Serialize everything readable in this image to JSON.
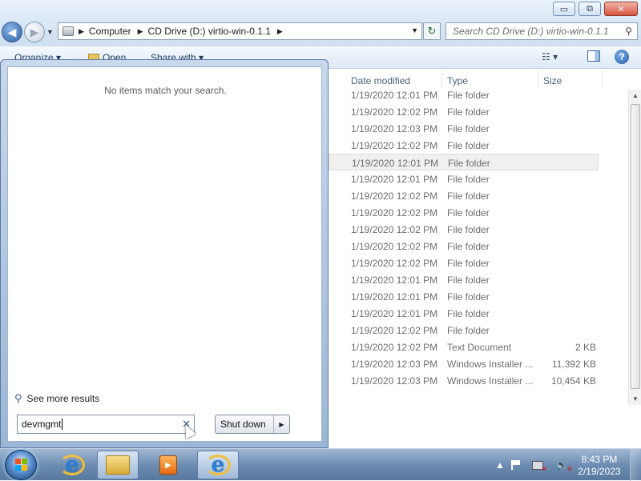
{
  "window": {
    "caption_buttons": {
      "minimize": "▭",
      "maximize": "⧉",
      "close": "✕"
    }
  },
  "navigation": {
    "back_glyph": "◀",
    "forward_glyph": "▶",
    "breadcrumbs": [
      "Computer",
      "CD Drive (D:) virtio-win-0.1.1"
    ],
    "search_placeholder": "Search CD Drive (D:) virtio-win-0.1.1"
  },
  "toolbar": {
    "organize": "Organize ▾",
    "open": "Open",
    "share_with": "Share with ▾",
    "views": "☷ ▾",
    "help": "?"
  },
  "columns": {
    "date_modified": "Date modified",
    "type": "Type",
    "size": "Size"
  },
  "files": [
    {
      "date": "1/19/2020 12:01 PM",
      "type": "File folder",
      "size": ""
    },
    {
      "date": "1/19/2020 12:02 PM",
      "type": "File folder",
      "size": ""
    },
    {
      "date": "1/19/2020 12:03 PM",
      "type": "File folder",
      "size": ""
    },
    {
      "date": "1/19/2020 12:02 PM",
      "type": "File folder",
      "size": ""
    },
    {
      "date": "1/19/2020 12:01 PM",
      "type": "File folder",
      "size": ""
    },
    {
      "date": "1/19/2020 12:01 PM",
      "type": "File folder",
      "size": ""
    },
    {
      "date": "1/19/2020 12:02 PM",
      "type": "File folder",
      "size": ""
    },
    {
      "date": "1/19/2020 12:02 PM",
      "type": "File folder",
      "size": ""
    },
    {
      "date": "1/19/2020 12:02 PM",
      "type": "File folder",
      "size": ""
    },
    {
      "date": "1/19/2020 12:02 PM",
      "type": "File folder",
      "size": ""
    },
    {
      "date": "1/19/2020 12:02 PM",
      "type": "File folder",
      "size": ""
    },
    {
      "date": "1/19/2020 12:01 PM",
      "type": "File folder",
      "size": ""
    },
    {
      "date": "1/19/2020 12:01 PM",
      "type": "File folder",
      "size": ""
    },
    {
      "date": "1/19/2020 12:01 PM",
      "type": "File folder",
      "size": ""
    },
    {
      "date": "1/19/2020 12:02 PM",
      "type": "File folder",
      "size": ""
    },
    {
      "date": "1/19/2020 12:02 PM",
      "type": "Text Document",
      "size": "2 KB"
    },
    {
      "date": "1/19/2020 12:03 PM",
      "type": "Windows Installer ...",
      "size": "11,392 KB"
    },
    {
      "date": "1/19/2020 12:03 PM",
      "type": "Windows Installer ...",
      "size": "10,454 KB"
    }
  ],
  "hovered_row_index": 4,
  "start_menu": {
    "no_items_text": "No items match your search.",
    "see_more": "See more results",
    "search_value": "devmgmt",
    "clear_glyph": "✕",
    "shutdown_label": "Shut down",
    "shutdown_arrow": "▶"
  },
  "taskbar": {
    "clock_time": "8:43 PM",
    "clock_date": "2/19/2023",
    "tray_up_arrow": "▲"
  },
  "colors": {
    "accent": "#2a5ea8",
    "taskbar": "#6a8ab0",
    "tray_error": "#d4161a"
  },
  "icons": [
    "drive-icon",
    "refresh-icon",
    "search-icon",
    "folder-icon",
    "help-icon",
    "ie-icon",
    "wmp-icon",
    "flag-icon",
    "network-icon",
    "volume-icon"
  ]
}
